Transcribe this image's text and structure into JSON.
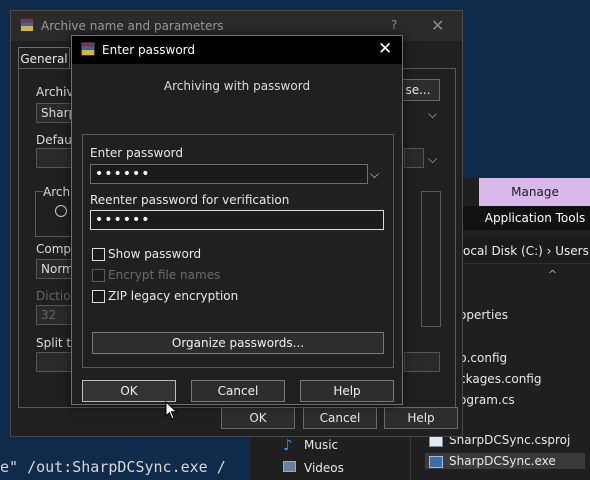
{
  "console": {
    "text": "e\" /out:SharpDCSync.exe /"
  },
  "explorer": {
    "manage_tab": "Manage",
    "application_tools": "Application Tools",
    "address": "ocal Disk (C:)  ›  Users",
    "files": [
      "operties",
      "p.config",
      "ckages.config",
      "ogram.cs",
      "SharpDCSync.csproj",
      "SharpDCSync.exe"
    ],
    "nav": [
      "Music",
      "Videos"
    ]
  },
  "archive_dialog": {
    "title": "Archive name and parameters",
    "help": "?",
    "close": "✕",
    "tab_general": "General",
    "archive_name_label": "Archive",
    "archive_name_value": "SharpD",
    "browse_button": "se...",
    "default_profile_label": "Default",
    "archive_format_label": "Archi",
    "compression_label": "Compre",
    "compression_value": "Normal",
    "dictionary_label": "Dictiona",
    "dictionary_value": "32",
    "split_label": "Split to",
    "ok": "OK",
    "cancel": "Cancel",
    "help_button": "Help"
  },
  "password_dialog": {
    "title": "Enter password",
    "close": "✕",
    "subtitle": "Archiving with password",
    "enter_password_label": "Enter password",
    "enter_password_value": "••••••",
    "reenter_label": "Reenter password for verification",
    "reenter_value": "••••••",
    "show_password": "Show password",
    "encrypt_file_names": "Encrypt file names",
    "zip_legacy": "ZIP legacy encryption",
    "organize_button": "Organize passwords...",
    "ok": "OK",
    "cancel": "Cancel",
    "help": "Help"
  }
}
